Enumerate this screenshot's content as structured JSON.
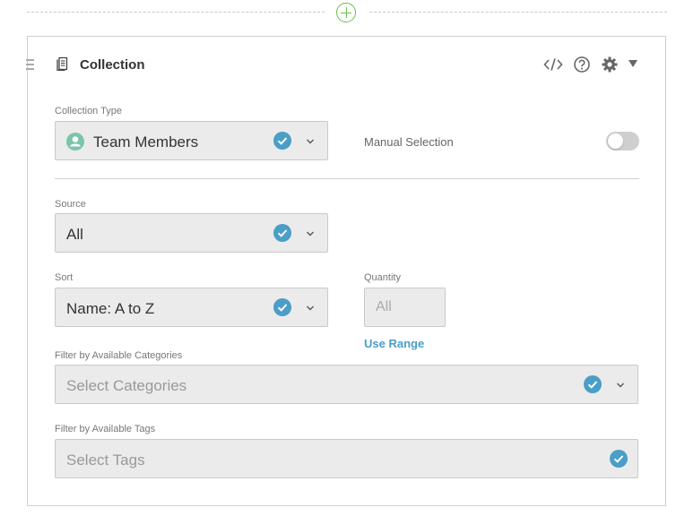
{
  "panel": {
    "title": "Collection"
  },
  "collection_type": {
    "label": "Collection Type",
    "value": "Team Members",
    "icon": "team-members-icon"
  },
  "manual_selection": {
    "label": "Manual Selection",
    "enabled": false
  },
  "source": {
    "label": "Source",
    "value": "All"
  },
  "sort": {
    "label": "Sort",
    "value": "Name: A to Z"
  },
  "quantity": {
    "label": "Quantity",
    "placeholder": "All",
    "use_range_label": "Use Range"
  },
  "categories": {
    "label": "Filter by Available Categories",
    "placeholder": "Select Categories"
  },
  "tags": {
    "label": "Filter by Available Tags",
    "placeholder": "Select Tags"
  },
  "colors": {
    "accent": "#4a9ec7",
    "add_green": "#6cbf4b",
    "team_icon": "#7cc4a8",
    "field_bg": "#ebebeb",
    "toggle_off": "#cfcfcf"
  }
}
